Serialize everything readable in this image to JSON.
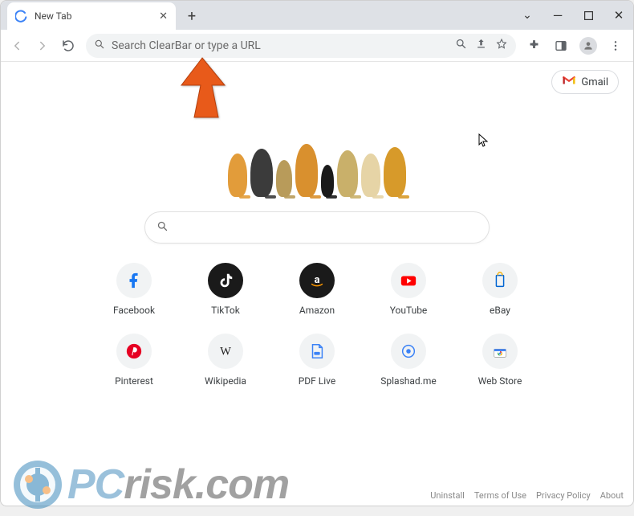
{
  "window": {
    "tab_title": "New Tab"
  },
  "toolbar": {
    "omnibox_placeholder": "Search ClearBar or type a URL"
  },
  "top_right": {
    "gmail_label": "Gmail"
  },
  "shortcuts": [
    {
      "name": "facebook",
      "label": "Facebook"
    },
    {
      "name": "tiktok",
      "label": "TikTok"
    },
    {
      "name": "amazon",
      "label": "Amazon"
    },
    {
      "name": "youtube",
      "label": "YouTube"
    },
    {
      "name": "ebay",
      "label": "eBay"
    },
    {
      "name": "pinterest",
      "label": "Pinterest"
    },
    {
      "name": "wikipedia",
      "label": "Wikipedia"
    },
    {
      "name": "pdflive",
      "label": "PDF Live"
    },
    {
      "name": "splashed",
      "label": "Splashad.me"
    },
    {
      "name": "webstore",
      "label": "Web Store"
    }
  ],
  "footer": {
    "uninstall": "Uninstall",
    "terms": "Terms of Use",
    "privacy": "Privacy Policy",
    "about": "About"
  },
  "watermark": {
    "text_prefix": "PC",
    "text_suffix": "risk.com"
  }
}
